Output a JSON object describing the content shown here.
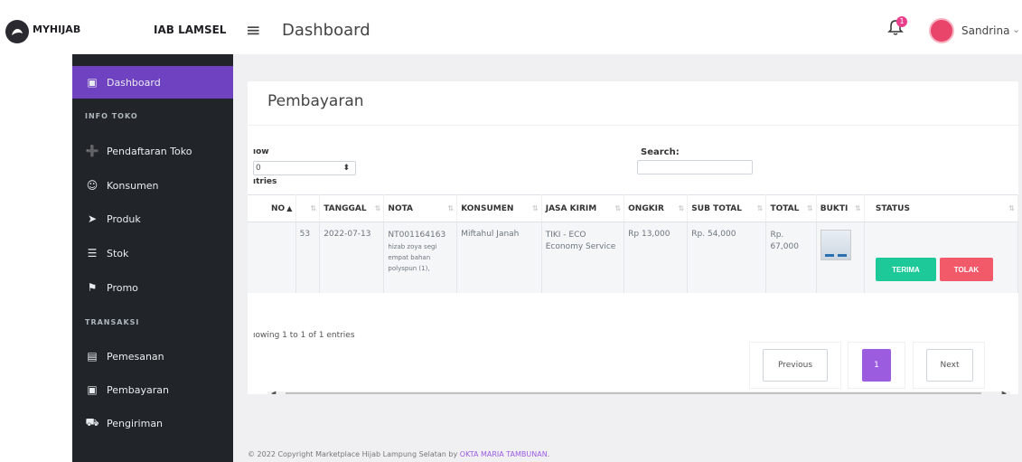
{
  "brand": {
    "name": "MYHIJAB",
    "name2": "IAB LAMSEL"
  },
  "header": {
    "title": "Dashboard",
    "notification_count": "1",
    "user_name": "Sandrina"
  },
  "sidebar": {
    "items": [
      {
        "label": "Dashboard",
        "icon": "id-card-icon",
        "active": true
      },
      {
        "label": "Pendaftaran Toko",
        "icon": "user-plus-icon"
      },
      {
        "label": "Konsumen",
        "icon": "users-icon"
      },
      {
        "label": "Produk",
        "icon": "product-add-icon"
      },
      {
        "label": "Stok",
        "icon": "list-icon"
      },
      {
        "label": "Promo",
        "icon": "promo-icon"
      },
      {
        "label": "Pemesanan",
        "icon": "order-list-icon"
      },
      {
        "label": "Pembayaran",
        "icon": "payment-icon"
      },
      {
        "label": "Pengiriman",
        "icon": "truck-icon"
      }
    ],
    "sections": {
      "info_toko": "INFO TOKO",
      "transaksi": "TRANSAKSI"
    }
  },
  "card": {
    "title": "Pembayaran",
    "show_label": "ıow",
    "entries_select_value": "0",
    "entries_label": "ıtries",
    "search_label": "Search:",
    "search_value": ""
  },
  "table": {
    "columns": [
      "NO",
      "",
      "TANGGAL",
      "NOTA",
      "KONSUMEN",
      "JASA KIRIM",
      "ONGKIR",
      "SUB TOTAL",
      "TOTAL",
      "BUKTI",
      "STATUS"
    ],
    "rows": [
      {
        "no": "",
        "id": "53",
        "tanggal": "2022-07-13",
        "nota_id": "NT001164163",
        "nota_desc": "hizab zoya segi empat bahan polyspun (1),",
        "konsumen": "Miftahul Janah",
        "jasa_kirim": "TIKI - ECO Economy Service",
        "ongkir": "Rp 13,000",
        "sub_total": "Rp. 54,000",
        "total": "Rp. 67,000",
        "bukti_icon": "receipt-image-icon"
      }
    ],
    "btn_terima": "TERIMA",
    "btn_tolak": "TOLAK"
  },
  "pagination": {
    "info": "ıowing 1 to 1 of 1 entries",
    "previous": "Previous",
    "current": "1",
    "next": "Next"
  },
  "footer": {
    "text": "© 2022 Copyright Marketplace Hijab Lampung Selatan by ",
    "link": "OKTA MARIA TAMBUNAN",
    "suffix": "."
  },
  "colors": {
    "accent": "#6f42c1",
    "sidebar_bg": "#212529",
    "success": "#1dc998",
    "danger": "#f25969"
  }
}
